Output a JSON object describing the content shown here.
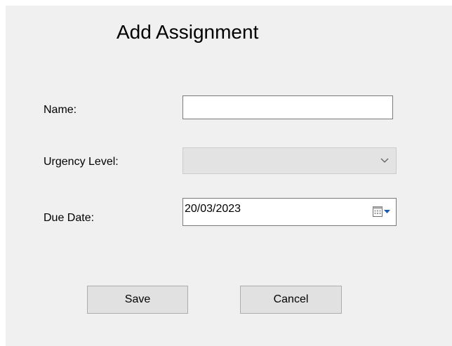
{
  "dialog": {
    "title": "Add Assignment"
  },
  "form": {
    "name_label": "Name:",
    "name_value": "",
    "urgency_label": "Urgency Level:",
    "urgency_value": "",
    "due_label": "Due Date:",
    "due_value": "20/03/2023"
  },
  "buttons": {
    "save_label": "Save",
    "cancel_label": "Cancel"
  },
  "icons": {
    "combo_arrow": "chevron-down-icon",
    "date_dropdown": "calendar-icon"
  },
  "colors": {
    "window_bg": "#f0f0f0",
    "input_border": "#7a7a7a",
    "button_bg": "#e1e1e1"
  }
}
